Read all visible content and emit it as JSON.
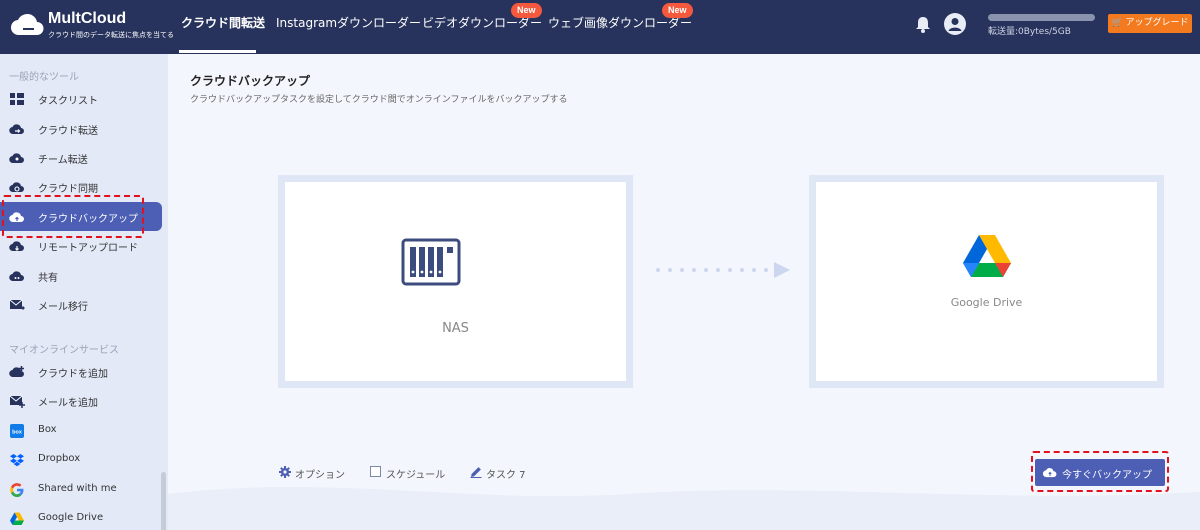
{
  "app": {
    "name": "MultCloud",
    "tagline": "クラウド間のデータ転送に焦点を当てる"
  },
  "nav": {
    "tabs": [
      {
        "label": "クラウド間転送",
        "active": true
      },
      {
        "label": "Instagramダウンローダー"
      },
      {
        "label": "ビデオダウンローダー",
        "badge": "New"
      },
      {
        "label": "ウェブ画像ダウンローダー",
        "badge": "New"
      }
    ]
  },
  "header": {
    "quota_text": "転送量:0Bytes/5GB",
    "quota_fraction": 0.0,
    "upgrade_label": "アップグレード"
  },
  "sidebar": {
    "section_tools": "一般的なツール",
    "tools": [
      {
        "label": "タスクリスト",
        "icon": "grid-icon"
      },
      {
        "label": "クラウド転送",
        "icon": "cloud-transfer-icon"
      },
      {
        "label": "チーム転送",
        "icon": "team-transfer-icon"
      },
      {
        "label": "クラウド同期",
        "icon": "cloud-sync-icon"
      },
      {
        "label": "クラウドバックアップ",
        "icon": "cloud-backup-icon",
        "active": true
      },
      {
        "label": "リモートアップロード",
        "icon": "remote-upload-icon"
      },
      {
        "label": "共有",
        "icon": "share-icon"
      },
      {
        "label": "メール移行",
        "icon": "email-migration-icon"
      }
    ],
    "section_services": "マイオンラインサービス",
    "services": [
      {
        "label": "クラウドを追加",
        "icon": "add-cloud-icon"
      },
      {
        "label": "メールを追加",
        "icon": "add-email-icon"
      },
      {
        "label": "Box",
        "icon": "box-icon"
      },
      {
        "label": "Dropbox",
        "icon": "dropbox-icon"
      },
      {
        "label": "Shared with me",
        "icon": "google-icon"
      },
      {
        "label": "Google Drive",
        "icon": "google-drive-icon"
      }
    ]
  },
  "main": {
    "title": "クラウドバックアップ",
    "subtitle": "クラウドバックアップタスクを設定してクラウド間でオンラインファイルをバックアップする",
    "source_label": "NAS",
    "destination_label": "Google Drive",
    "options_label": "オプション",
    "schedule_label": "スケジュール",
    "task_label": "タスク 7",
    "run_label": "今すぐバックアップ"
  },
  "colors": {
    "topbar": "#27335c",
    "accent": "#4c5fb5",
    "upgrade": "#f47a20",
    "badge": "#f4583d",
    "highlight": "#e3101d"
  }
}
